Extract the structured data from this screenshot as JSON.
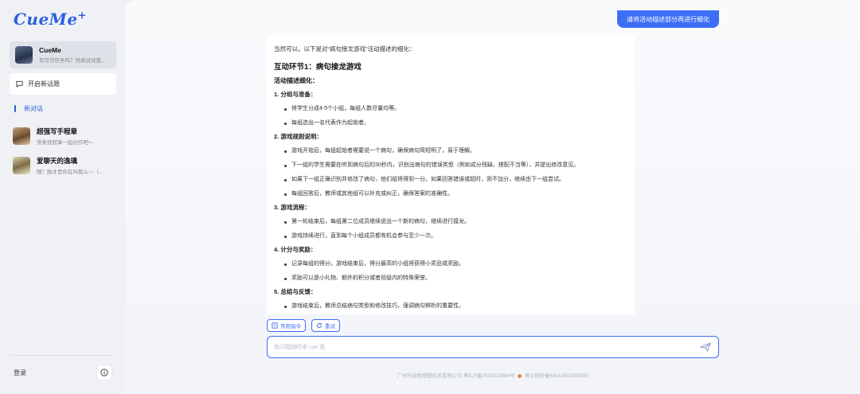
{
  "app": {
    "logo": "CueMe",
    "logo_plus": "+"
  },
  "sidebar": {
    "assistant": {
      "title": "CueMe",
      "subtitle": "有写作任务吗？快来试试我..."
    },
    "new_topic_label": "开启新话题",
    "active_conversation": "新对话",
    "conversations": [
      {
        "title": "超强写手程章",
        "subtitle": "快来找程章一起创作吧～"
      },
      {
        "title": "爱聊天的逸璃",
        "subtitle": "嘿？刚才是你在叫我么～（..."
      }
    ],
    "login_label": "登录",
    "info_label": "i"
  },
  "chat": {
    "user_message": "请将活动描述部分再进行细化",
    "answer": {
      "intro": "当然可以。以下是对“病句接龙游戏”活动描述的细化：",
      "heading": "互动环节1：病句接龙游戏",
      "subheading": "活动描述细化：",
      "sections": [
        {
          "title": "1. 分组与准备：",
          "items": [
            "将学生分成4-5个小组，每组人数尽量均等。",
            "每组选出一名代表作为起始者。"
          ]
        },
        {
          "title": "2. 游戏规则说明：",
          "items": [
            "游戏开始后，每组起始者需要说一个病句，确保病句简短明了，易于理解。",
            "下一组的学生需要在听到病句后的30秒内，识别出病句的错误类型（例如成分残缺、搭配不当等），并提出修改意见。",
            "如果下一组正确识别并修改了病句，他们组将得到一分。如果回答错误或超时，则不加分，继续由下一组尝试。",
            "每组回答后，教师或其他组可以补充或纠正，确保答案的准确性。"
          ]
        },
        {
          "title": "3. 游戏流程：",
          "items": [
            "第一轮结束后，每组第二位成员继续说出一个新的病句，继续进行接龙。",
            "游戏持续进行，直到每个小组成员都有机会参与至少一次。"
          ]
        },
        {
          "title": "4. 计分与奖励：",
          "items": [
            "记录每组的得分，游戏结束后，得分最高的小组将获得小奖品或奖励。",
            "奖励可以是小礼物、额外的积分或者班级内的特殊荣誉。"
          ]
        },
        {
          "title": "5. 总结与反馈：",
          "items": [
            "游戏结束后，教师总结病句类型和修改技巧，强调病句辨析的重要性。"
          ]
        }
      ]
    },
    "tools": {
      "common_commands": "常用指令",
      "retry": "重试"
    },
    "input": {
      "placeholder": "有问题随时来 cue 我",
      "value": ""
    },
    "footer": {
      "icp": "广州市动物想想技术有限公司 粤ICP备2023013984号",
      "police": "粤公网安备44010502000055"
    }
  },
  "colors": {
    "accent": "#3d6ef5",
    "sidebar_bg": "#eff1f5",
    "main_bg": "#f6f7fb"
  }
}
